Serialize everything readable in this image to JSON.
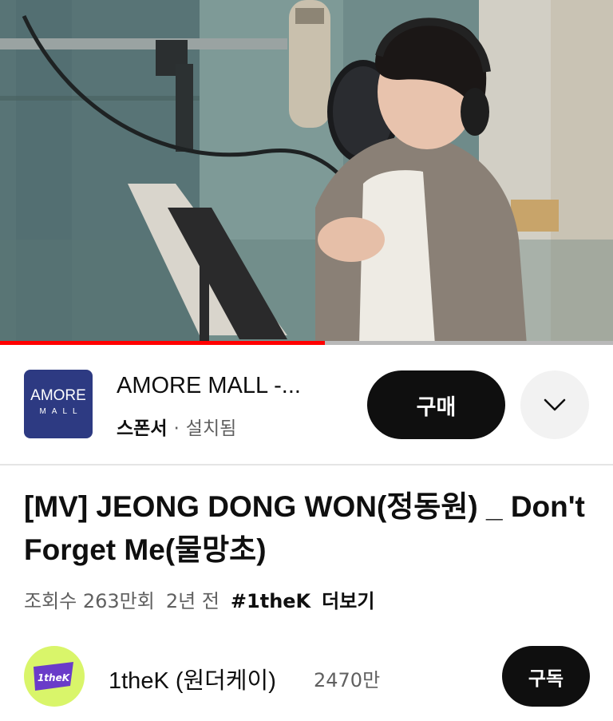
{
  "player": {
    "progress": 0.53,
    "progress_color": "#ff0000"
  },
  "ad": {
    "logo_top": "AMORE",
    "logo_bottom": "MALL",
    "logo_color": "#2d3a82",
    "title": "AMORE MALL -...",
    "sponsor_label": "스폰서",
    "separator": "·",
    "status": "설치됨",
    "buy_label": "구매",
    "expand_icon": "chevron-down-icon"
  },
  "video": {
    "title": "[MV] JEONG DONG WON(정동원) _ Don't Forget Me(물망초)",
    "views": "조회수 263만회",
    "age": "2년 전",
    "hashtag": "#1theK",
    "more": "더보기"
  },
  "channel": {
    "avatar_text": "1theK",
    "name": "1theK (원더케이)",
    "subscribers": "2470만",
    "subscribe_label": "구독"
  }
}
